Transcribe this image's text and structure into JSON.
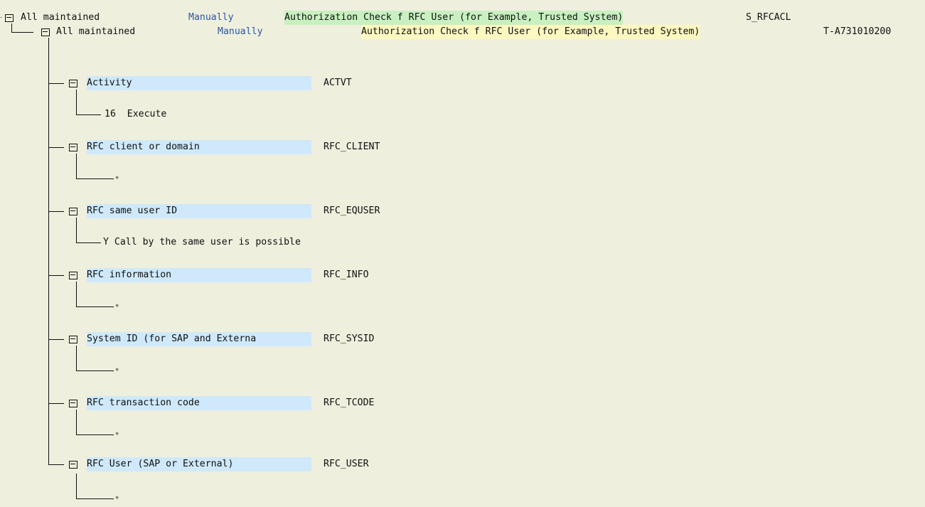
{
  "root": {
    "status": "All maintained",
    "origin": "Manually",
    "text": "Authorization Check f RFC User (for Example, Trusted System)",
    "code": "S_RFCACL"
  },
  "auth": {
    "status": "All maintained",
    "origin": "Manually",
    "text": "Authorization Check f RFC User (for Example, Trusted System)",
    "code": "T-A731010200"
  },
  "fields": [
    {
      "label": "Activity",
      "name": "ACTVT",
      "value": "16  Execute"
    },
    {
      "label": "RFC client or domain",
      "name": "RFC_CLIENT",
      "value": "*"
    },
    {
      "label": "RFC same user ID",
      "name": "RFC_EQUSER",
      "value": "Y Call by the same user is possible"
    },
    {
      "label": "RFC information",
      "name": "RFC_INFO",
      "value": "*"
    },
    {
      "label": "System ID (for SAP and Externa",
      "name": "RFC_SYSID",
      "value": "*"
    },
    {
      "label": "RFC transaction code",
      "name": "RFC_TCODE",
      "value": "*"
    },
    {
      "label": "RFC User (SAP or External)",
      "name": "RFC_USER",
      "value": "*"
    }
  ],
  "colors": {
    "background": "#efefde",
    "origin_text": "#2d57a0",
    "root_highlight": "#c8f0c0",
    "auth_highlight": "#fdf7c0",
    "field_highlight": "#cfe9fa"
  },
  "icons": {
    "node": "folder-open-icon"
  }
}
